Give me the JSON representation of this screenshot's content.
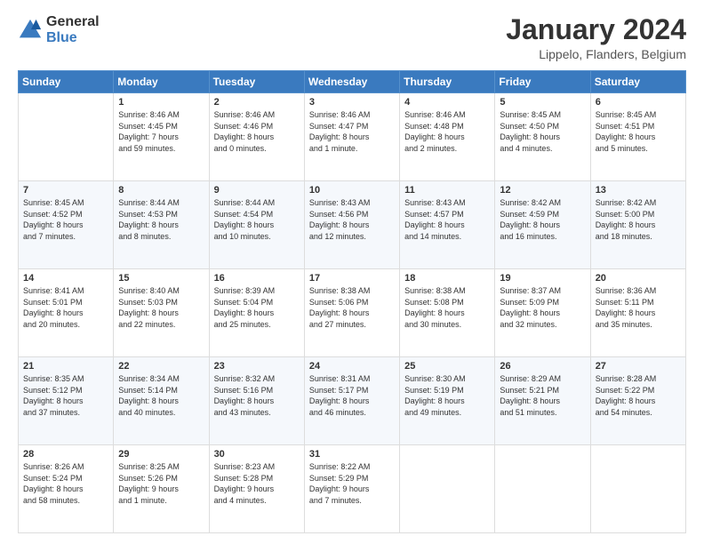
{
  "header": {
    "logo_line1": "General",
    "logo_line2": "Blue",
    "title": "January 2024",
    "subtitle": "Lippelo, Flanders, Belgium"
  },
  "days_of_week": [
    "Sunday",
    "Monday",
    "Tuesday",
    "Wednesday",
    "Thursday",
    "Friday",
    "Saturday"
  ],
  "weeks": [
    [
      {
        "num": "",
        "info": ""
      },
      {
        "num": "1",
        "info": "Sunrise: 8:46 AM\nSunset: 4:45 PM\nDaylight: 7 hours\nand 59 minutes."
      },
      {
        "num": "2",
        "info": "Sunrise: 8:46 AM\nSunset: 4:46 PM\nDaylight: 8 hours\nand 0 minutes."
      },
      {
        "num": "3",
        "info": "Sunrise: 8:46 AM\nSunset: 4:47 PM\nDaylight: 8 hours\nand 1 minute."
      },
      {
        "num": "4",
        "info": "Sunrise: 8:46 AM\nSunset: 4:48 PM\nDaylight: 8 hours\nand 2 minutes."
      },
      {
        "num": "5",
        "info": "Sunrise: 8:45 AM\nSunset: 4:50 PM\nDaylight: 8 hours\nand 4 minutes."
      },
      {
        "num": "6",
        "info": "Sunrise: 8:45 AM\nSunset: 4:51 PM\nDaylight: 8 hours\nand 5 minutes."
      }
    ],
    [
      {
        "num": "7",
        "info": "Sunrise: 8:45 AM\nSunset: 4:52 PM\nDaylight: 8 hours\nand 7 minutes."
      },
      {
        "num": "8",
        "info": "Sunrise: 8:44 AM\nSunset: 4:53 PM\nDaylight: 8 hours\nand 8 minutes."
      },
      {
        "num": "9",
        "info": "Sunrise: 8:44 AM\nSunset: 4:54 PM\nDaylight: 8 hours\nand 10 minutes."
      },
      {
        "num": "10",
        "info": "Sunrise: 8:43 AM\nSunset: 4:56 PM\nDaylight: 8 hours\nand 12 minutes."
      },
      {
        "num": "11",
        "info": "Sunrise: 8:43 AM\nSunset: 4:57 PM\nDaylight: 8 hours\nand 14 minutes."
      },
      {
        "num": "12",
        "info": "Sunrise: 8:42 AM\nSunset: 4:59 PM\nDaylight: 8 hours\nand 16 minutes."
      },
      {
        "num": "13",
        "info": "Sunrise: 8:42 AM\nSunset: 5:00 PM\nDaylight: 8 hours\nand 18 minutes."
      }
    ],
    [
      {
        "num": "14",
        "info": "Sunrise: 8:41 AM\nSunset: 5:01 PM\nDaylight: 8 hours\nand 20 minutes."
      },
      {
        "num": "15",
        "info": "Sunrise: 8:40 AM\nSunset: 5:03 PM\nDaylight: 8 hours\nand 22 minutes."
      },
      {
        "num": "16",
        "info": "Sunrise: 8:39 AM\nSunset: 5:04 PM\nDaylight: 8 hours\nand 25 minutes."
      },
      {
        "num": "17",
        "info": "Sunrise: 8:38 AM\nSunset: 5:06 PM\nDaylight: 8 hours\nand 27 minutes."
      },
      {
        "num": "18",
        "info": "Sunrise: 8:38 AM\nSunset: 5:08 PM\nDaylight: 8 hours\nand 30 minutes."
      },
      {
        "num": "19",
        "info": "Sunrise: 8:37 AM\nSunset: 5:09 PM\nDaylight: 8 hours\nand 32 minutes."
      },
      {
        "num": "20",
        "info": "Sunrise: 8:36 AM\nSunset: 5:11 PM\nDaylight: 8 hours\nand 35 minutes."
      }
    ],
    [
      {
        "num": "21",
        "info": "Sunrise: 8:35 AM\nSunset: 5:12 PM\nDaylight: 8 hours\nand 37 minutes."
      },
      {
        "num": "22",
        "info": "Sunrise: 8:34 AM\nSunset: 5:14 PM\nDaylight: 8 hours\nand 40 minutes."
      },
      {
        "num": "23",
        "info": "Sunrise: 8:32 AM\nSunset: 5:16 PM\nDaylight: 8 hours\nand 43 minutes."
      },
      {
        "num": "24",
        "info": "Sunrise: 8:31 AM\nSunset: 5:17 PM\nDaylight: 8 hours\nand 46 minutes."
      },
      {
        "num": "25",
        "info": "Sunrise: 8:30 AM\nSunset: 5:19 PM\nDaylight: 8 hours\nand 49 minutes."
      },
      {
        "num": "26",
        "info": "Sunrise: 8:29 AM\nSunset: 5:21 PM\nDaylight: 8 hours\nand 51 minutes."
      },
      {
        "num": "27",
        "info": "Sunrise: 8:28 AM\nSunset: 5:22 PM\nDaylight: 8 hours\nand 54 minutes."
      }
    ],
    [
      {
        "num": "28",
        "info": "Sunrise: 8:26 AM\nSunset: 5:24 PM\nDaylight: 8 hours\nand 58 minutes."
      },
      {
        "num": "29",
        "info": "Sunrise: 8:25 AM\nSunset: 5:26 PM\nDaylight: 9 hours\nand 1 minute."
      },
      {
        "num": "30",
        "info": "Sunrise: 8:23 AM\nSunset: 5:28 PM\nDaylight: 9 hours\nand 4 minutes."
      },
      {
        "num": "31",
        "info": "Sunrise: 8:22 AM\nSunset: 5:29 PM\nDaylight: 9 hours\nand 7 minutes."
      },
      {
        "num": "",
        "info": ""
      },
      {
        "num": "",
        "info": ""
      },
      {
        "num": "",
        "info": ""
      }
    ]
  ]
}
